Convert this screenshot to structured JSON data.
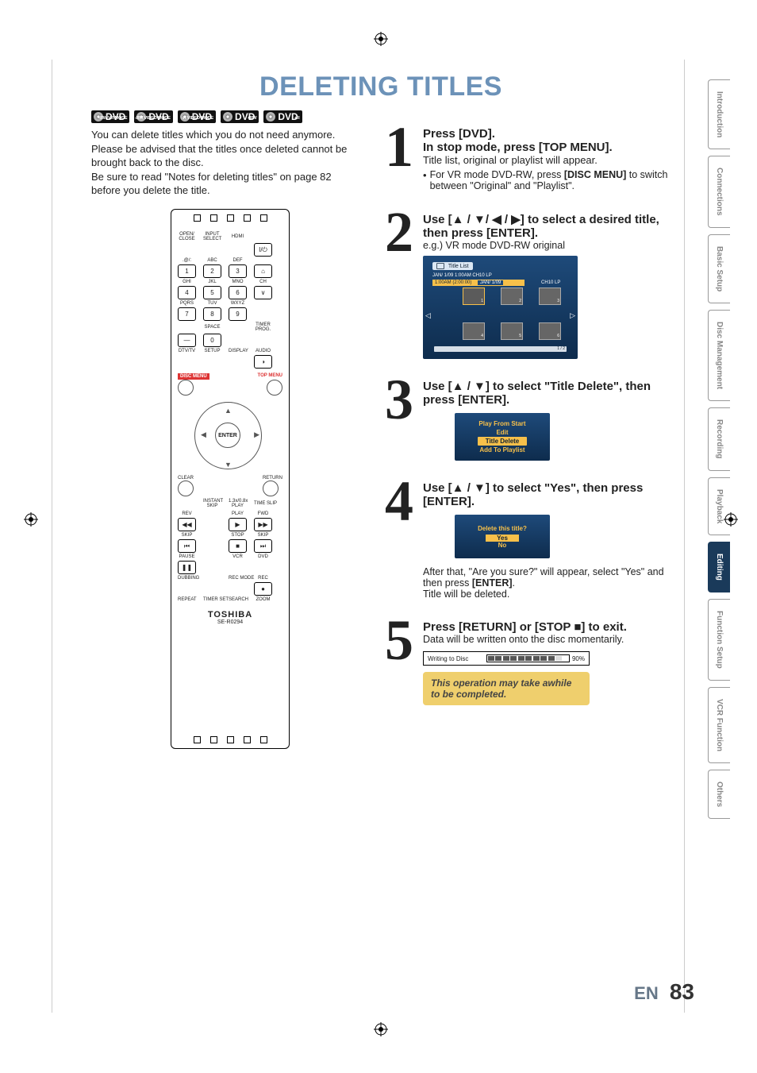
{
  "page_title": "DELETING TITLES",
  "disc_badges": [
    {
      "main": "DVD",
      "sub": "-RW VR MODE"
    },
    {
      "main": "DVD",
      "sub": "-RW VIDEO MODE"
    },
    {
      "main": "DVD",
      "sub": "-R VIDEO MODE"
    },
    {
      "main": "DVD",
      "sub": "+RW"
    },
    {
      "main": "DVD",
      "sub": "+R"
    }
  ],
  "intro_lines": [
    "You can delete titles which you do not need anymore.",
    "Please be advised that the titles once deleted cannot be brought back to the disc.",
    "Be sure to read \"Notes for deleting titles\" on page 82 before you delete the title."
  ],
  "remote": {
    "brand": "TOSHIBA",
    "model": "SE-R0294",
    "row1": [
      "OPEN/\nCLOSE",
      "INPUT\nSELECT",
      "HDMI",
      ""
    ],
    "keys1": [
      "",
      "",
      "",
      "I/⏻"
    ],
    "row2": [
      ".@/:",
      "ABC",
      "DEF",
      ""
    ],
    "keys2": [
      "1",
      "2",
      "3",
      "⌂"
    ],
    "row3": [
      "GHI",
      "JKL",
      "MNO",
      "CH"
    ],
    "keys3": [
      "4",
      "5",
      "6",
      "∨"
    ],
    "row4": [
      "PQRS",
      "TUV",
      "WXYZ",
      ""
    ],
    "keys4": [
      "7",
      "8",
      "9",
      ""
    ],
    "row5": [
      "",
      "SPACE",
      "",
      "TIMER\nPROG."
    ],
    "keys5": [
      "—",
      "0",
      "",
      ""
    ],
    "row6": [
      "DTV/TV",
      "SETUP",
      "DISPLAY",
      "AUDIO"
    ],
    "keys6": [
      "",
      "",
      "",
      "◑"
    ],
    "disc_menu": "DISC MENU",
    "top_menu": "TOP MENU",
    "enter": "ENTER",
    "clear": "CLEAR",
    "return": "RETURN",
    "midrow1": [
      "",
      "INSTANT\nSKIP",
      "1.3x/0.8x\nPLAY",
      "TIME SLIP"
    ],
    "midrow2": [
      "REV",
      "",
      "PLAY",
      "FWD"
    ],
    "keys_mid2": [
      "◀◀",
      "",
      "▶",
      "▶▶"
    ],
    "midrow3": [
      "SKIP",
      "",
      "STOP",
      "SKIP"
    ],
    "keys_mid3": [
      "⏮",
      "",
      "■",
      "⏭"
    ],
    "midrow4": [
      "PAUSE",
      "",
      "VCR",
      "DVD"
    ],
    "keys_mid4": [
      "❚❚",
      "",
      "",
      ""
    ],
    "midrow5": [
      "DUBBING",
      "",
      "REC MODE",
      "REC"
    ],
    "keys_mid5": [
      "",
      "",
      "",
      "●"
    ],
    "midrow6": [
      "REPEAT",
      "TIMER SET",
      "SEARCH",
      "ZOOM"
    ]
  },
  "steps": {
    "s1": {
      "title": "Press [DVD].",
      "sub": "In stop mode, press [TOP MENU].",
      "line": "Title list, original or playlist will appear.",
      "bullet": "For VR mode DVD-RW, press [DISC MENU] to switch between \"Original\" and \"Playlist\"."
    },
    "s2": {
      "main": "Use [▲ / ▼/ ◀ / ▶] to select a desired title, then press [ENTER].",
      "eg": "e.g.) VR mode DVD-RW original",
      "screen": {
        "hdr": "Title List",
        "sub": "JAN/ 1/09 1:00AM  CH10   LP",
        "hi_l": "1:00AM (2:00:00)",
        "hi_r1": "JAN/ 1/09",
        "hi_r2": "CH10   LP",
        "cells": [
          "1",
          "2",
          "3",
          "4",
          "5",
          "6"
        ],
        "page": "1 / 2"
      }
    },
    "s3": {
      "main": "Use [▲ / ▼] to select \"Title Delete\", then press [ENTER].",
      "menu": [
        "Play From Start",
        "Edit",
        "Title Delete",
        "Add To Playlist"
      ],
      "sel": 2
    },
    "s4": {
      "main": "Use [▲ / ▼] to select \"Yes\", then press [ENTER].",
      "q": "Delete this title?",
      "opts": [
        "Yes",
        "No"
      ],
      "sel": 0,
      "after": "After that, \"Are you sure?\" will appear, select \"Yes\" and then press [ENTER].",
      "after2": "Title will be deleted."
    },
    "s5": {
      "main": "Press [RETURN] or [STOP ■] to exit.",
      "line": "Data will be written onto the disc momentarily.",
      "write": "Writing to Disc",
      "pct": "90%",
      "warn": "This operation may take awhile to be completed."
    }
  },
  "tabs": [
    "Introduction",
    "Connections",
    "Basic Setup",
    "Disc Management",
    "Recording",
    "Playback",
    "Editing",
    "Function Setup",
    "VCR Function",
    "Others"
  ],
  "active_tab": 6,
  "footer": {
    "lang": "EN",
    "page": "83"
  }
}
